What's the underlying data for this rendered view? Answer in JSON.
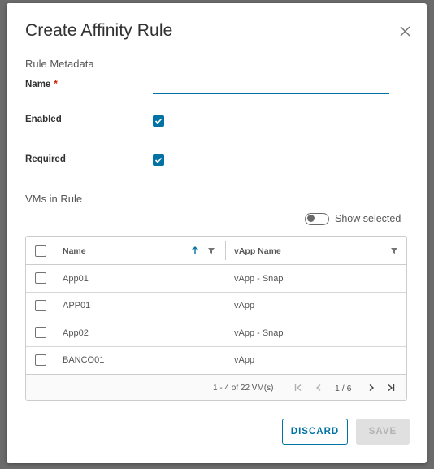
{
  "dialog": {
    "title": "Create Affinity Rule",
    "close_icon": "close-icon"
  },
  "metadata": {
    "section_label": "Rule Metadata",
    "name_label": "Name",
    "required_marker": "*",
    "name_value": "",
    "enabled_label": "Enabled",
    "enabled_checked": true,
    "required_label": "Required",
    "required_checked": true
  },
  "vms": {
    "section_label": "VMs in Rule",
    "show_selected_label": "Show selected",
    "show_selected_on": false,
    "columns": {
      "name": "Name",
      "vapp": "vApp Name"
    },
    "rows": [
      {
        "name": "App01",
        "vapp": "vApp - Snap",
        "checked": false
      },
      {
        "name": "APP01",
        "vapp": "vApp",
        "checked": false
      },
      {
        "name": "App02",
        "vapp": "vApp - Snap",
        "checked": false
      },
      {
        "name": "BANCO01",
        "vapp": "vApp",
        "checked": false
      }
    ],
    "footer": {
      "count_text": "1 - 4 of 22 VM(s)",
      "page_text": "1 / 6"
    }
  },
  "actions": {
    "discard_label": "DISCARD",
    "save_label": "SAVE"
  },
  "colors": {
    "accent": "#0072a3",
    "required": "#c92100",
    "disabled_bg": "#e0e0e0"
  }
}
